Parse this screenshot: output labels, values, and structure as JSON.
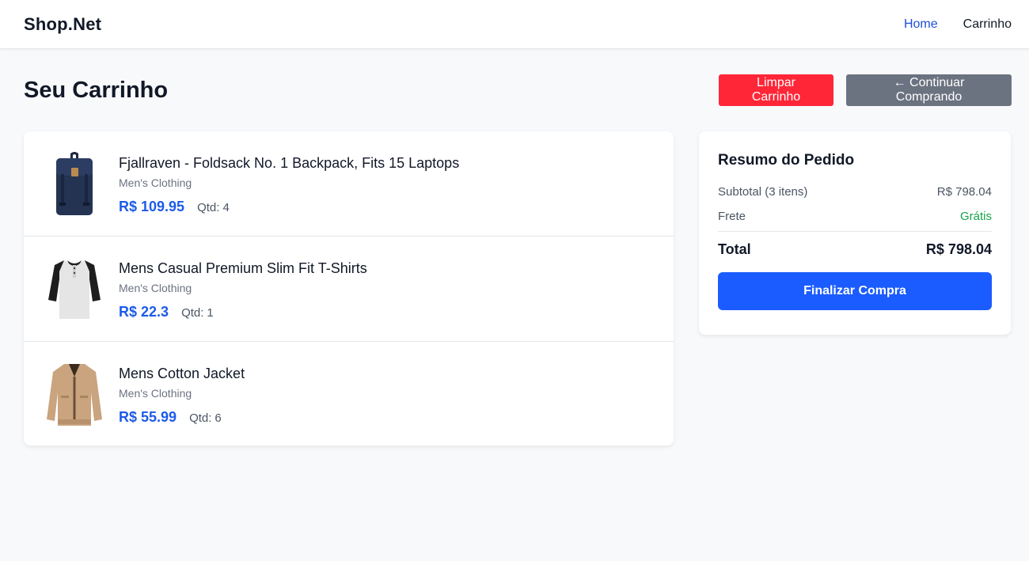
{
  "header": {
    "brand": "Shop.Net",
    "nav": [
      {
        "label": "Home",
        "active": true
      },
      {
        "label": "Carrinho",
        "active": false
      }
    ]
  },
  "page": {
    "title": "Seu Carrinho",
    "clear_button": "Limpar Carrinho",
    "continue_button": "← Continuar Comprando"
  },
  "cart": {
    "currency": "R$",
    "qty_label": "Qtd:",
    "items": [
      {
        "title": "Fjallraven - Foldsack No. 1 Backpack, Fits 15 Laptops",
        "category": "Men's Clothing",
        "price": "109.95",
        "qty": "4",
        "icon": "backpack-image"
      },
      {
        "title": "Mens Casual Premium Slim Fit T-Shirts",
        "category": "Men's Clothing",
        "price": "22.3",
        "qty": "1",
        "icon": "tshirt-image"
      },
      {
        "title": "Mens Cotton Jacket",
        "category": "Men's Clothing",
        "price": "55.99",
        "qty": "6",
        "icon": "jacket-image"
      }
    ]
  },
  "summary": {
    "title": "Resumo do Pedido",
    "subtotal_label": "Subtotal (3 itens)",
    "subtotal_value": "R$ 798.04",
    "shipping_label": "Frete",
    "shipping_value": "Grátis",
    "total_label": "Total",
    "total_value": "R$ 798.04",
    "checkout_button": "Finalizar Compra"
  },
  "colors": {
    "primary": "#1a5cff",
    "danger": "#ff2637",
    "secondary": "#6b7280",
    "success": "#16a34a",
    "price": "#1d5be8"
  }
}
